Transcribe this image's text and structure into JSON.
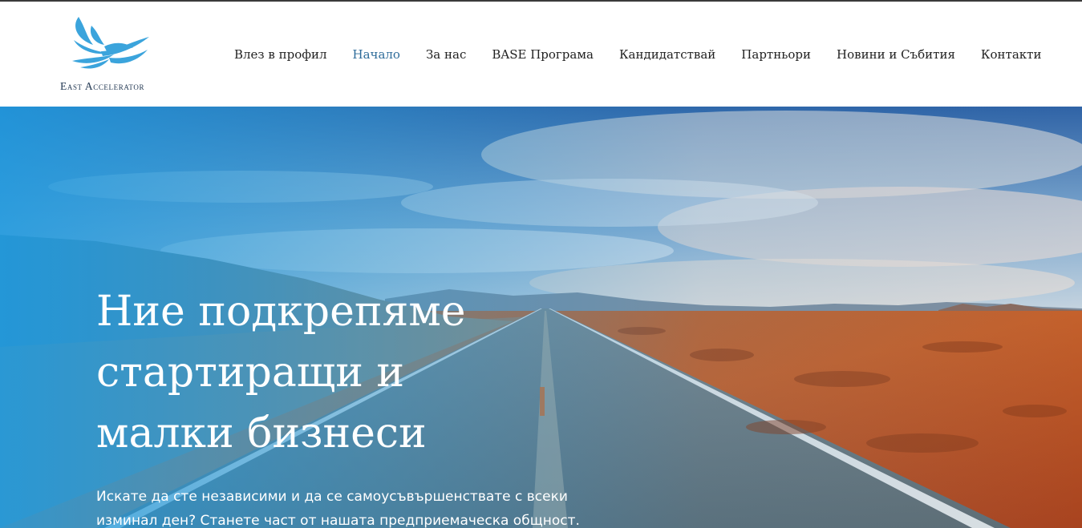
{
  "brand": {
    "name": "East Accelerator"
  },
  "nav": {
    "items": [
      {
        "label": "Влез в профил",
        "active": false
      },
      {
        "label": "Начало",
        "active": true
      },
      {
        "label": "За нас",
        "active": false
      },
      {
        "label": "BASE Програма",
        "active": false
      },
      {
        "label": "Кандидатствай",
        "active": false
      },
      {
        "label": "Партньори",
        "active": false
      },
      {
        "label": "Новини и Събития",
        "active": false
      },
      {
        "label": "Контакти",
        "active": false
      }
    ],
    "active_color": "#2e6c9a"
  },
  "hero": {
    "title": "Ние подкрепяме стартиращи и малки бизнеси",
    "subtitle": "Искате да сте независими и да се самоусъвършенствате с всеки изминал ден? Станете част от нашата предприемаческа общност."
  },
  "colors": {
    "brand_blue": "#3ba4dc",
    "text_dark": "#222222",
    "logo_text": "#1f3550"
  }
}
